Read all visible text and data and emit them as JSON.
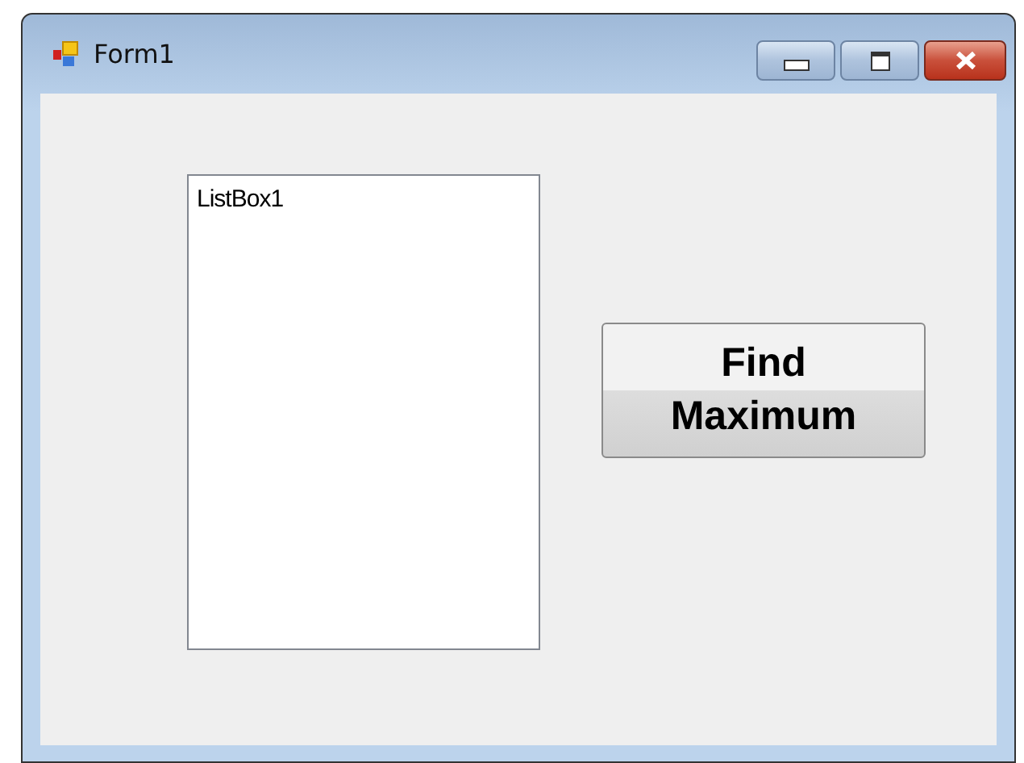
{
  "window": {
    "title": "Form1"
  },
  "list_box": {
    "items": [
      "ListBox1"
    ]
  },
  "buttons": [
    {
      "label": "Find Maximum"
    }
  ]
}
